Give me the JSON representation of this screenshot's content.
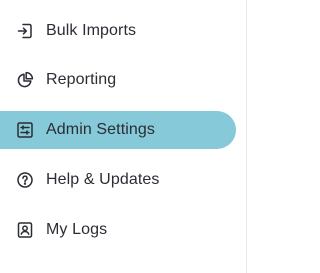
{
  "sidebar": {
    "accent_color": "#86c9d9",
    "items": [
      {
        "label": "Bulk Imports",
        "icon": "import-icon",
        "active": false
      },
      {
        "label": "Reporting",
        "icon": "pie-chart-icon",
        "active": false
      },
      {
        "label": "Admin Settings",
        "icon": "settings-sliders-icon",
        "active": true
      },
      {
        "label": "Help & Updates",
        "icon": "help-circle-icon",
        "active": false
      },
      {
        "label": "My Logs",
        "icon": "user-log-icon",
        "active": false
      }
    ]
  }
}
